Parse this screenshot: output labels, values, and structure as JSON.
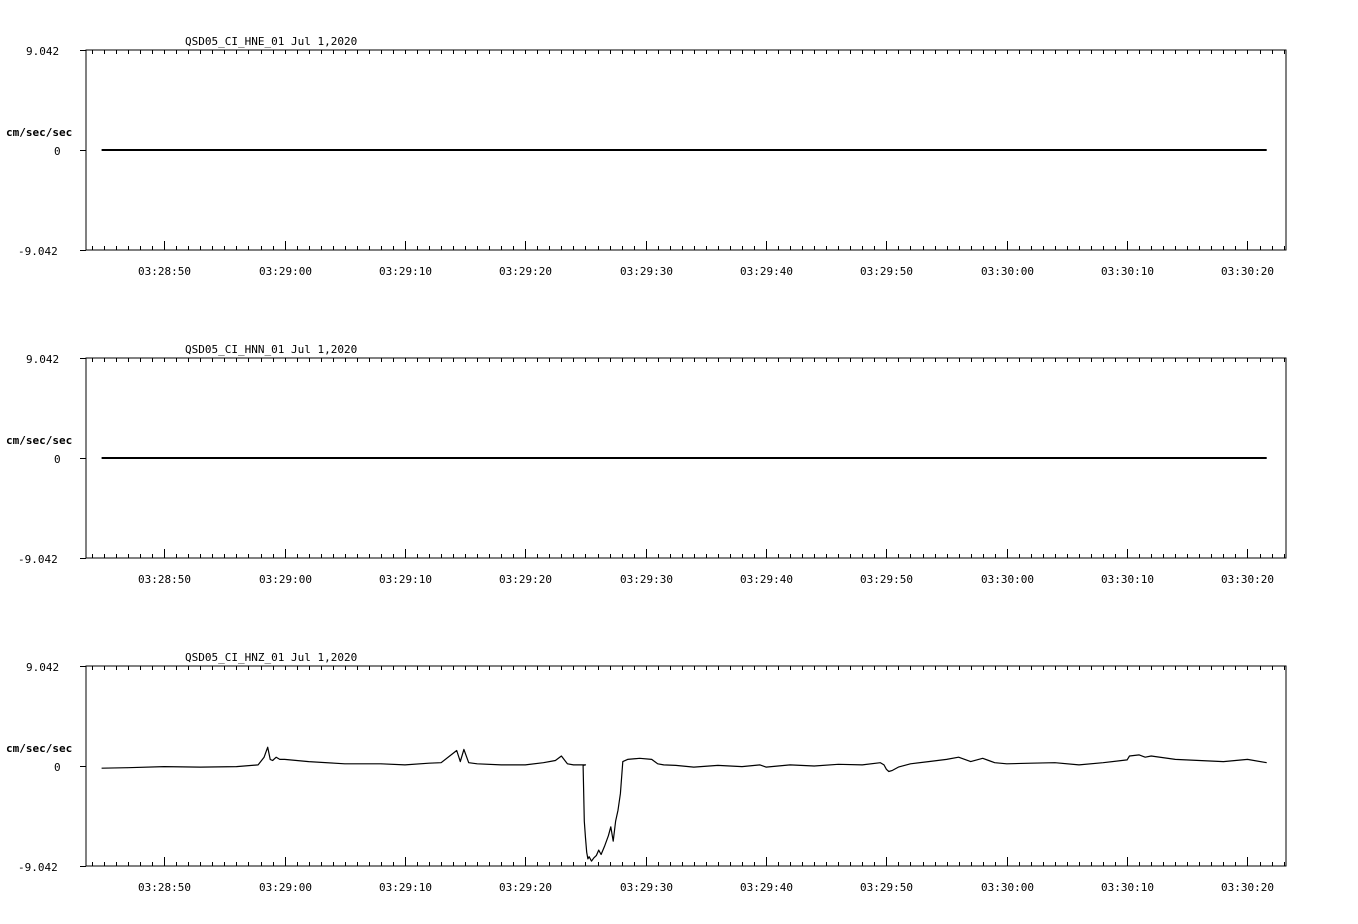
{
  "chart_data": [
    {
      "type": "line",
      "title": "QSD05_CI_HNE_01  Jul 1,2020",
      "ylabel": "cm/sec/sec",
      "ytick_labels": [
        "9.042",
        "0",
        "-9.042"
      ],
      "ylim": [
        -9.042,
        9.042
      ],
      "xlim_seconds": [
        43.5,
        143.2
      ],
      "xtick_labels": [
        "03:28:50",
        "03:29:00",
        "03:29:10",
        "03:29:20",
        "03:29:30",
        "03:29:40",
        "03:29:50",
        "03:30:00",
        "03:30:10",
        "03:30:20"
      ],
      "xtick_seconds": [
        50,
        60,
        70,
        80,
        90,
        100,
        110,
        120,
        130,
        140
      ],
      "series": [
        {
          "x": [
            44.8,
            141.6
          ],
          "y": [
            0,
            0
          ]
        }
      ]
    },
    {
      "type": "line",
      "title": "QSD05_CI_HNN_01  Jul 1,2020",
      "ylabel": "cm/sec/sec",
      "ytick_labels": [
        "9.042",
        "0",
        "-9.042"
      ],
      "ylim": [
        -9.042,
        9.042
      ],
      "xlim_seconds": [
        43.5,
        143.2
      ],
      "xtick_labels": [
        "03:28:50",
        "03:29:00",
        "03:29:10",
        "03:29:20",
        "03:29:30",
        "03:29:40",
        "03:29:50",
        "03:30:00",
        "03:30:10",
        "03:30:20"
      ],
      "xtick_seconds": [
        50,
        60,
        70,
        80,
        90,
        100,
        110,
        120,
        130,
        140
      ],
      "series": [
        {
          "x": [
            44.8,
            141.6
          ],
          "y": [
            0,
            0
          ]
        }
      ]
    },
    {
      "type": "line",
      "title": "QSD05_CI_HNZ_01  Jul 1,2020",
      "ylabel": "cm/sec/sec",
      "ytick_labels": [
        "9.042",
        "0",
        "-9.042"
      ],
      "ylim": [
        -9.042,
        9.042
      ],
      "xlim_seconds": [
        43.5,
        143.2
      ],
      "xtick_labels": [
        "03:28:50",
        "03:29:00",
        "03:29:10",
        "03:29:20",
        "03:29:30",
        "03:29:40",
        "03:29:50",
        "03:30:00",
        "03:30:10",
        "03:30:20"
      ],
      "xtick_seconds": [
        50,
        60,
        70,
        80,
        90,
        100,
        110,
        120,
        130,
        140
      ],
      "series": [
        {
          "x": [
            44.8,
            47,
            50,
            53,
            56,
            57.8,
            58.3,
            58.6,
            58.8,
            59,
            59.3,
            59.6,
            60,
            62,
            65,
            68,
            70,
            72,
            73,
            74.3,
            74.6,
            74.9,
            75.3,
            76,
            78,
            80,
            81.5,
            82.5,
            83,
            83.5,
            84,
            85,
            84.8,
            84.9,
            85.0,
            85.1,
            85.2,
            85.3,
            85.5,
            85.7,
            85.9,
            86.1,
            86.3,
            86.6,
            86.9,
            87.1,
            87.3,
            87.5,
            87.7,
            87.9,
            88.1,
            88.5,
            89.5,
            90.5,
            91,
            91.5,
            92.5,
            94,
            96,
            98,
            99.5,
            100,
            102,
            104,
            106,
            108,
            109.5,
            109.8,
            110,
            110.2,
            110.5,
            111,
            112,
            113.5,
            115,
            116,
            117,
            118,
            118.5,
            119,
            120,
            122,
            124,
            126,
            128,
            130,
            130.2,
            131,
            131.5,
            132,
            134,
            136,
            138,
            140,
            141.6
          ],
          "y": [
            -0.2,
            -0.15,
            -0.05,
            -0.1,
            -0.05,
            0.1,
            0.8,
            1.7,
            0.6,
            0.5,
            0.8,
            0.6,
            0.6,
            0.4,
            0.2,
            0.2,
            0.1,
            0.25,
            0.3,
            1.4,
            0.4,
            1.5,
            0.3,
            0.2,
            0.1,
            0.1,
            0.3,
            0.5,
            0.9,
            0.2,
            0.1,
            0.1,
            0.05,
            -5.0,
            -6.5,
            -7.8,
            -8.4,
            -8.2,
            -8.6,
            -8.3,
            -8.1,
            -7.6,
            -8.0,
            -7.2,
            -6.3,
            -5.5,
            -6.8,
            -5.0,
            -4.0,
            -2.5,
            0.4,
            0.6,
            0.7,
            0.6,
            0.2,
            0.1,
            0.05,
            -0.1,
            0.05,
            -0.05,
            0.1,
            -0.1,
            0.1,
            0.0,
            0.15,
            0.1,
            0.3,
            0.1,
            -0.3,
            -0.5,
            -0.4,
            -0.1,
            0.2,
            0.4,
            0.6,
            0.8,
            0.4,
            0.7,
            0.5,
            0.3,
            0.2,
            0.25,
            0.3,
            0.1,
            0.3,
            0.55,
            0.9,
            1.0,
            0.8,
            0.9,
            0.6,
            0.5,
            0.4,
            0.6,
            0.3
          ]
        }
      ]
    }
  ]
}
